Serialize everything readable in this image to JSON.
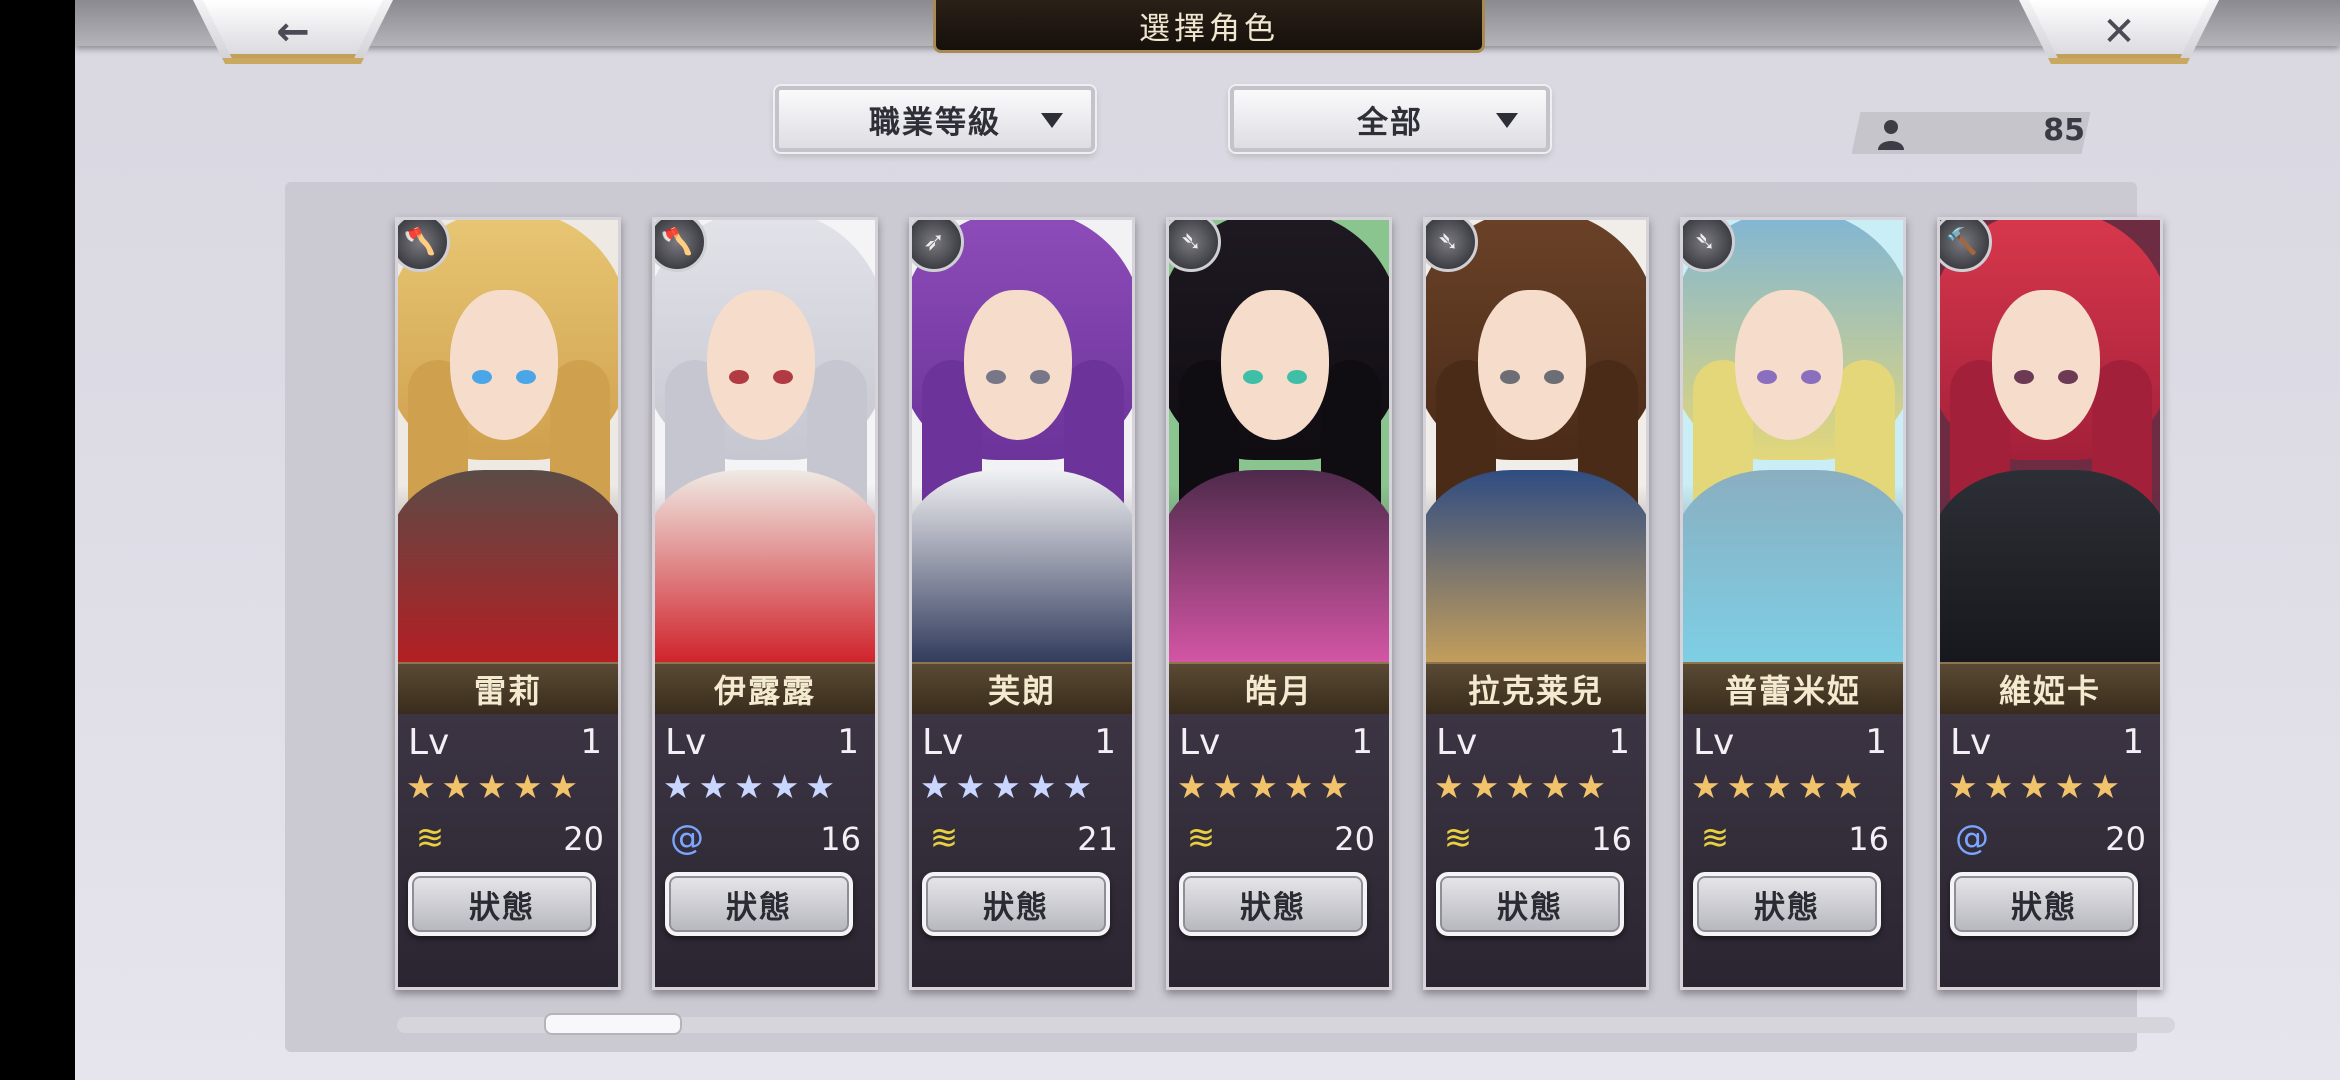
{
  "header": {
    "title": "選擇角色",
    "back_glyph": "←",
    "close_glyph": "✕"
  },
  "filters": {
    "job_level": "職業等級",
    "all": "全部"
  },
  "count": {
    "value": "85",
    "icon": "person-icon"
  },
  "characters": [
    {
      "name": "雷莉",
      "lv_label": "Lv",
      "lv": "1",
      "stars": "★★★★★",
      "star_color": "#f1c36a",
      "element": "wing",
      "stat": "20",
      "status": "狀態"
    },
    {
      "name": "伊露露",
      "lv_label": "Lv",
      "lv": "1",
      "stars": "★★★★★",
      "star_color": "#c9d6ff",
      "element": "swirl",
      "stat": "16",
      "status": "狀態"
    },
    {
      "name": "芙朗",
      "lv_label": "Lv",
      "lv": "1",
      "stars": "★★★★★",
      "star_color": "#c9d6ff",
      "element": "wing",
      "stat": "21",
      "status": "狀態"
    },
    {
      "name": "皓月",
      "lv_label": "Lv",
      "lv": "1",
      "stars": "★★★★★",
      "star_color": "#f1c36a",
      "element": "wing",
      "stat": "20",
      "status": "狀態"
    },
    {
      "name": "拉克莱兒",
      "lv_label": "Lv",
      "lv": "1",
      "stars": "★★★★★",
      "star_color": "#f1c36a",
      "element": "wing",
      "stat": "16",
      "status": "狀態"
    },
    {
      "name": "普蕾米婭",
      "lv_label": "Lv",
      "lv": "1",
      "stars": "★★★★★",
      "star_color": "#f1c36a",
      "element": "wing",
      "stat": "16",
      "status": "狀態"
    },
    {
      "name": "維婭卡",
      "lv_label": "Lv",
      "lv": "1",
      "stars": "★★★★★",
      "star_color": "#f1c36a",
      "element": "swirl",
      "stat": "20",
      "status": "狀態"
    }
  ]
}
